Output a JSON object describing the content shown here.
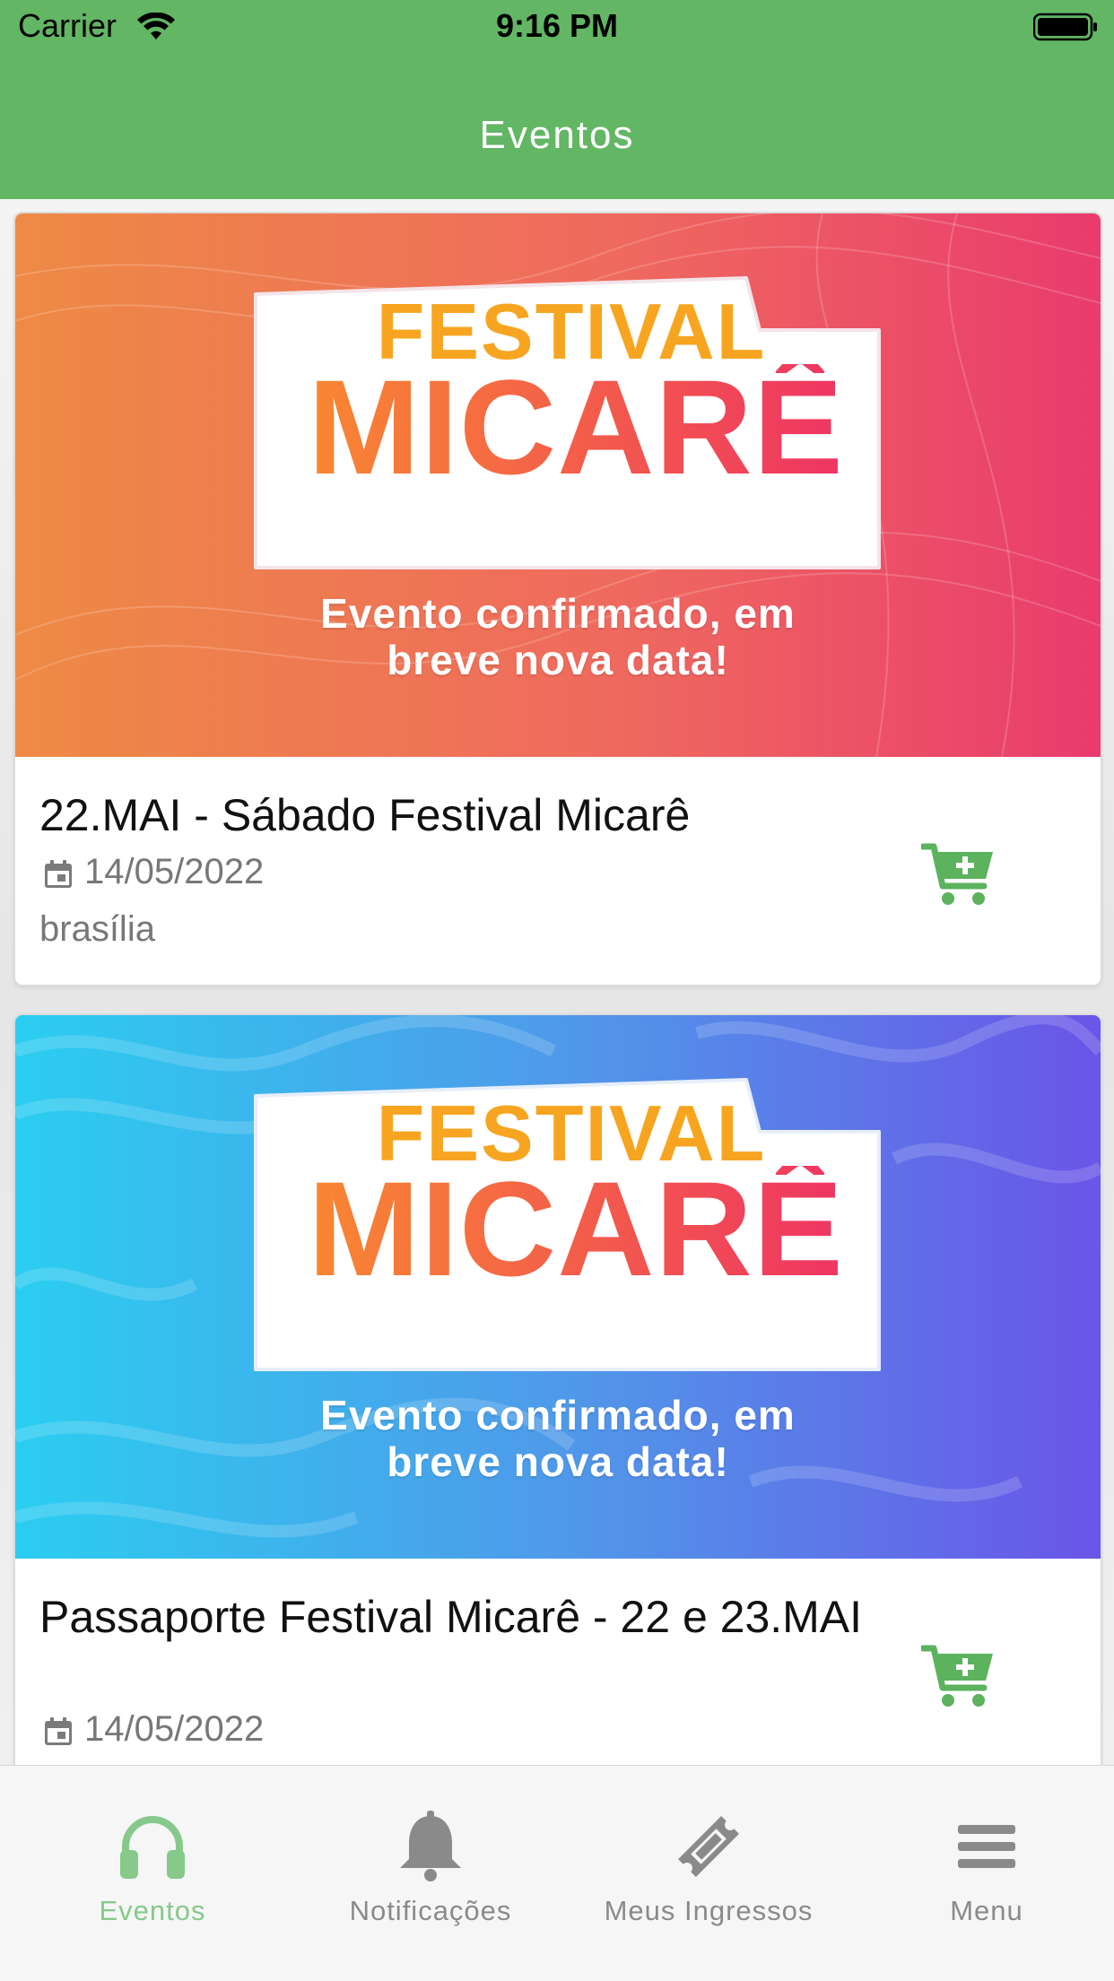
{
  "status_bar": {
    "carrier": "Carrier",
    "time": "9:16 PM"
  },
  "nav": {
    "title": "Eventos"
  },
  "colors": {
    "accent": "#63b664",
    "tab_active": "#86c98a",
    "tab_inactive": "#8a8a8a",
    "cart": "#5cb25d"
  },
  "events": [
    {
      "banner": {
        "line1": "FESTIVAL",
        "line2": "MICARÊ",
        "caption_1": "Evento confirmado, em",
        "caption_2": "breve nova data!",
        "theme": "orange-pink"
      },
      "title": "22.MAI - Sábado Festival Micarê",
      "date": "14/05/2022",
      "location": "brasília",
      "cart_icon": "cart-plus-icon"
    },
    {
      "banner": {
        "line1": "FESTIVAL",
        "line2": "MICARÊ",
        "caption_1": "Evento confirmado, em",
        "caption_2": "breve nova data!",
        "theme": "cyan-purple"
      },
      "title": "Passaporte Festival Micarê - 22 e 23.MAI",
      "date": "14/05/2022",
      "cart_icon": "cart-plus-icon"
    }
  ],
  "tabs": [
    {
      "label": "Eventos",
      "icon": "headphones-icon",
      "active": true
    },
    {
      "label": "Notificações",
      "icon": "bell-icon",
      "active": false
    },
    {
      "label": "Meus Ingressos",
      "icon": "ticket-icon",
      "active": false
    },
    {
      "label": "Menu",
      "icon": "menu-icon",
      "active": false
    }
  ]
}
